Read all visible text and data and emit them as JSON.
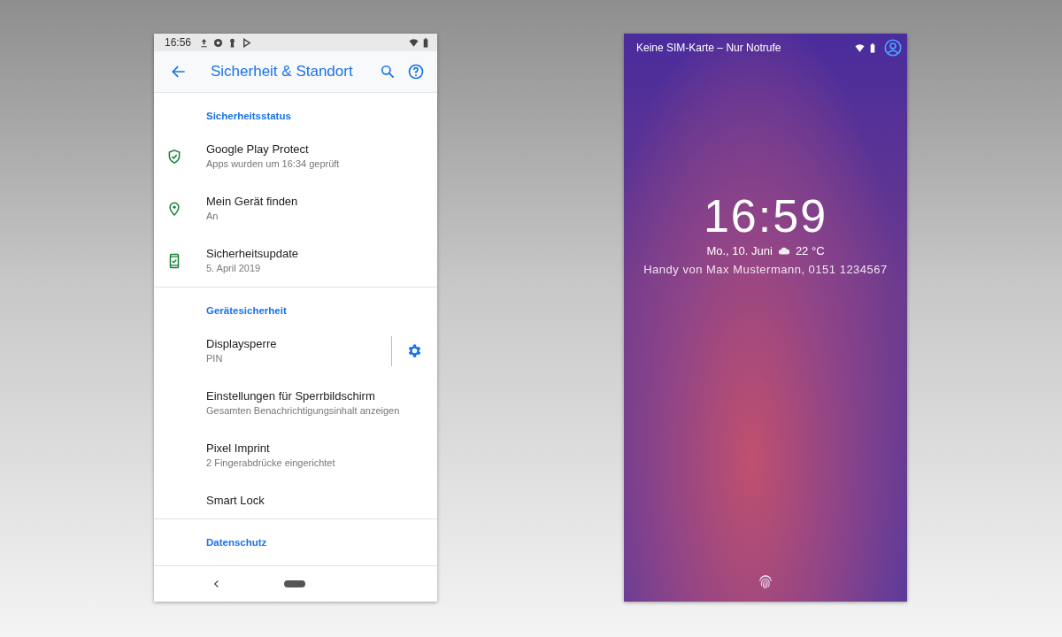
{
  "settings_phone": {
    "status_bar": {
      "time": "16:56"
    },
    "toolbar": {
      "title": "Sicherheit & Standort"
    },
    "sections": [
      {
        "header": "Sicherheitsstatus",
        "items": [
          {
            "kind": "shield",
            "title": "Google Play Protect",
            "subtitle": "Apps wurden um 16:34 geprüft"
          },
          {
            "kind": "pin",
            "title": "Mein Gerät finden",
            "subtitle": "An"
          },
          {
            "kind": "phone",
            "title": "Sicherheitsupdate",
            "subtitle": "5. April 2019"
          }
        ]
      },
      {
        "header": "Gerätesicherheit",
        "items": [
          {
            "kind": "settings",
            "title": "Displaysperre",
            "subtitle": "PIN"
          },
          {
            "kind": "plain",
            "title": "Einstellungen für Sperrbildschirm",
            "subtitle": "Gesamten Benachrichtigungsinhalt anzeigen"
          },
          {
            "kind": "plain",
            "title": "Pixel Imprint",
            "subtitle": "2 Fingerabdrücke eingerichtet"
          },
          {
            "kind": "plain",
            "title": "Smart Lock"
          }
        ]
      },
      {
        "header": "Datenschutz"
      }
    ]
  },
  "lock_screen": {
    "carrier_text": "Keine SIM-Karte – Nur Notrufe",
    "clock": "16:59",
    "date": "Mo., 10. Juni",
    "temperature": "22 °C",
    "owner_info": "Handy von Max Mustermann, 0151 1234567"
  }
}
